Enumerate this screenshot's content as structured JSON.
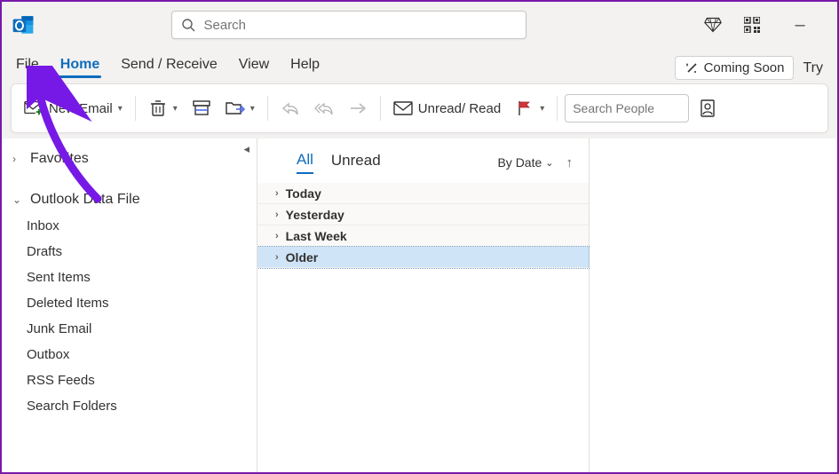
{
  "search": {
    "placeholder": "Search"
  },
  "titlebar": {
    "premium_icon": "diamond",
    "qr_icon": "qr"
  },
  "tabs": {
    "items": [
      "File",
      "Home",
      "Send / Receive",
      "View",
      "Help"
    ],
    "active_index": 1,
    "coming_soon": "Coming Soon",
    "try": "Try"
  },
  "ribbon": {
    "new_email": "New Email",
    "unread_read": "Unread/ Read",
    "search_people_placeholder": "Search People"
  },
  "nav": {
    "favorites": "Favorites",
    "data_file": "Outlook Data File",
    "folders": [
      "Inbox",
      "Drafts",
      "Sent Items",
      "Deleted Items",
      "Junk Email",
      "Outbox",
      "RSS Feeds",
      "Search Folders"
    ]
  },
  "list": {
    "filter_all": "All",
    "filter_unread": "Unread",
    "sort_label": "By Date",
    "groups": [
      "Today",
      "Yesterday",
      "Last Week",
      "Older"
    ],
    "selected_index": 3
  }
}
